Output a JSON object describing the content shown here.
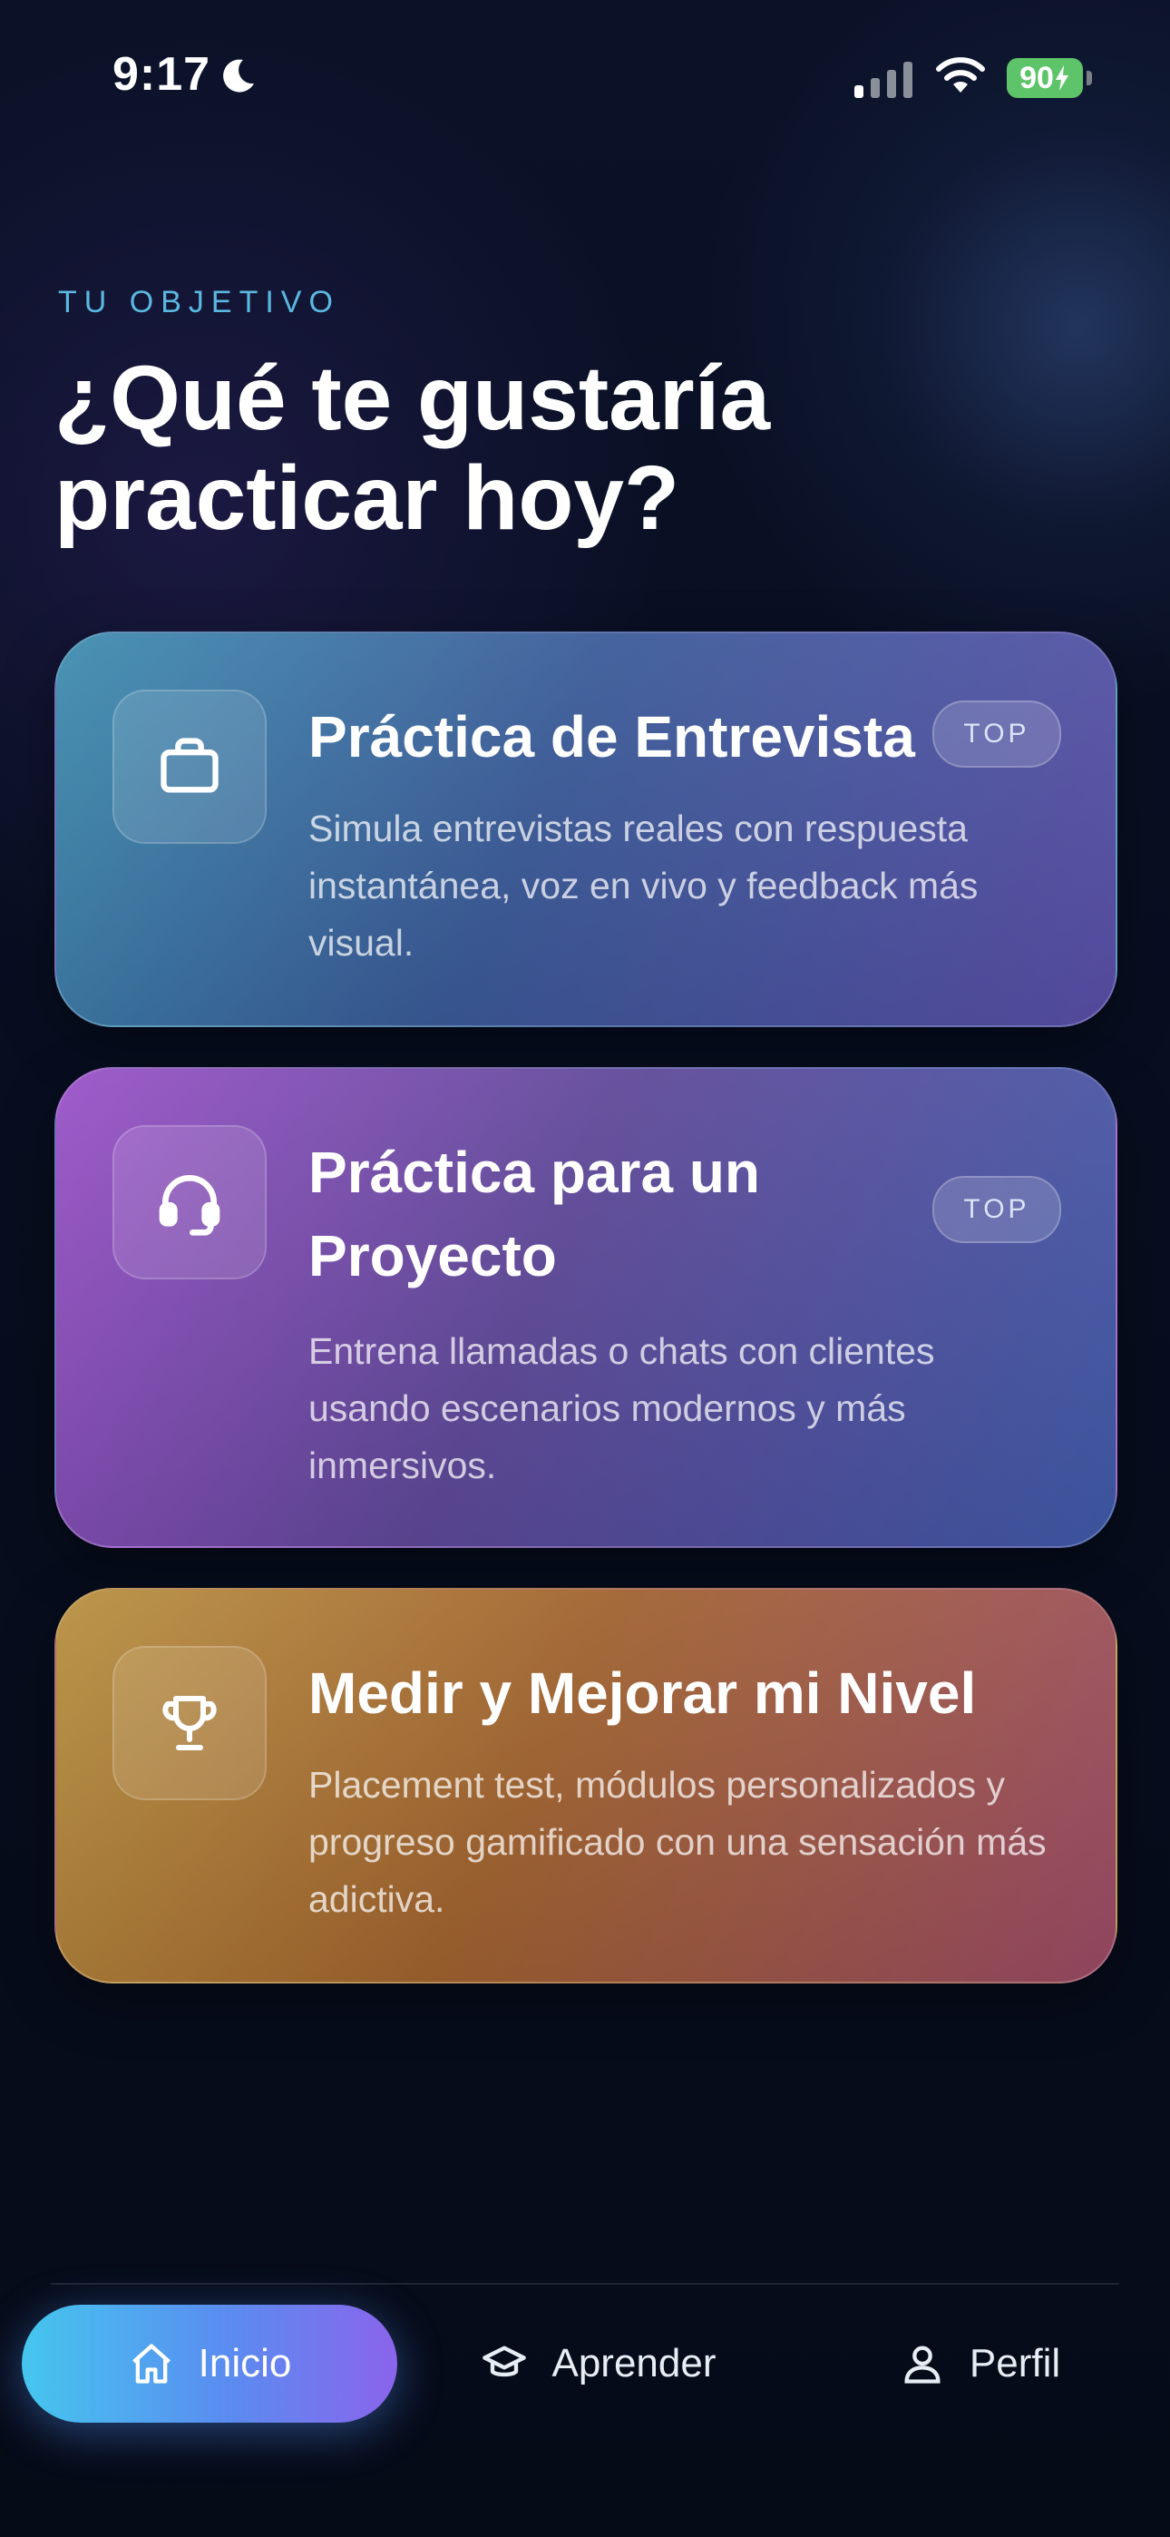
{
  "status_bar": {
    "time": "9:17",
    "battery": "90"
  },
  "header": {
    "eyebrow": "TU OBJETIVO",
    "title": "¿Qué te gustaría practicar hoy?"
  },
  "cards": [
    {
      "icon": "briefcase-icon",
      "title": "Práctica de Entrevista",
      "description": "Simula entrevistas reales con respuesta instantánea, voz en vivo y feedback más visual.",
      "badge": "TOP"
    },
    {
      "icon": "headset-icon",
      "title": "Práctica para un Proyecto",
      "description": "Entrena llamadas o chats con clientes usando escenarios modernos y más inmersivos.",
      "badge": "TOP"
    },
    {
      "icon": "trophy-icon",
      "title": "Medir y Mejorar mi Nivel",
      "description": "Placement test, módulos personalizados y progreso gamificado con una sensación más adictiva."
    }
  ],
  "nav": {
    "items": [
      {
        "label": "Inicio",
        "icon": "home-icon",
        "active": true
      },
      {
        "label": "Aprender",
        "icon": "graduation-cap-icon",
        "active": false
      },
      {
        "label": "Perfil",
        "icon": "user-icon",
        "active": false
      }
    ]
  },
  "colors": {
    "background": "#070d1c",
    "accent": "#5bb8e0",
    "nav_active_start": "#45c6ee",
    "nav_active_end": "#8a64ec",
    "battery": "#5ec46a"
  }
}
